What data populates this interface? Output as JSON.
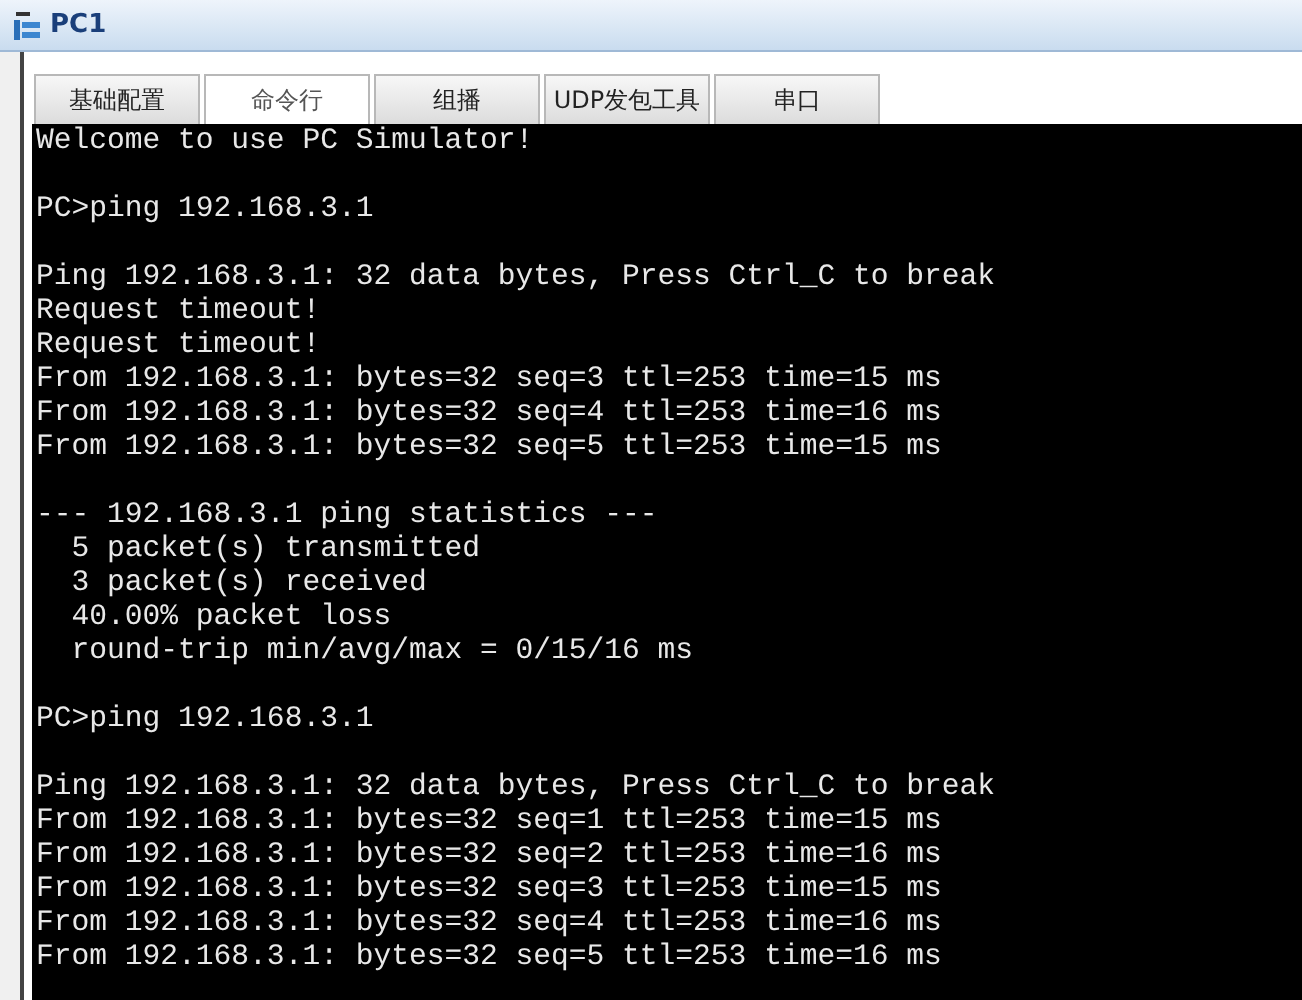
{
  "window": {
    "title": "PC1"
  },
  "tabs": [
    {
      "label": "基础配置",
      "selected": false
    },
    {
      "label": "命令行",
      "selected": true
    },
    {
      "label": "组播",
      "selected": false
    },
    {
      "label": "UDP发包工具",
      "selected": false
    },
    {
      "label": "串口",
      "selected": false
    }
  ],
  "terminal": {
    "blocks": [
      [
        "Welcome to use PC Simulator!"
      ],
      [
        "PC>ping 192.168.3.1"
      ],
      [
        "Ping 192.168.3.1: 32 data bytes, Press Ctrl_C to break",
        "Request timeout!",
        "Request timeout!",
        "From 192.168.3.1: bytes=32 seq=3 ttl=253 time=15 ms",
        "From 192.168.3.1: bytes=32 seq=4 ttl=253 time=16 ms",
        "From 192.168.3.1: bytes=32 seq=5 ttl=253 time=15 ms"
      ],
      [
        "--- 192.168.3.1 ping statistics ---",
        "  5 packet(s) transmitted",
        "  3 packet(s) received",
        "  40.00% packet loss",
        "  round-trip min/avg/max = 0/15/16 ms"
      ],
      [
        "PC>ping 192.168.3.1"
      ],
      [
        "Ping 192.168.3.1: 32 data bytes, Press Ctrl_C to break",
        "From 192.168.3.1: bytes=32 seq=1 ttl=253 time=15 ms",
        "From 192.168.3.1: bytes=32 seq=2 ttl=253 time=16 ms",
        "From 192.168.3.1: bytes=32 seq=3 ttl=253 time=15 ms",
        "From 192.168.3.1: bytes=32 seq=4 ttl=253 time=16 ms",
        "From 192.168.3.1: bytes=32 seq=5 ttl=253 time=16 ms"
      ]
    ]
  }
}
